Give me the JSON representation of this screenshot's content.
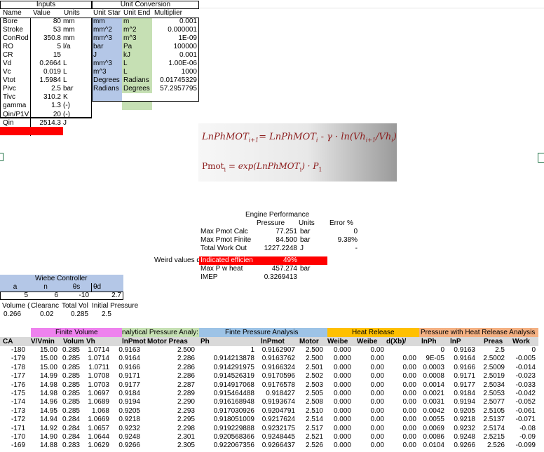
{
  "inputs": {
    "title": "Inputs",
    "headers": [
      "Name",
      "Value",
      "Units"
    ],
    "rows": [
      [
        "Bore",
        "80",
        "mm"
      ],
      [
        "Stroke",
        "53",
        "mm"
      ],
      [
        "ConRod",
        "350.8",
        "mm"
      ],
      [
        "RO",
        "5",
        "l/a"
      ],
      [
        "CR",
        "15",
        ""
      ],
      [
        "Vd",
        "0.2664",
        "L"
      ],
      [
        "Vc",
        "0.019",
        "L"
      ],
      [
        "Vtot",
        "1.5984",
        "L"
      ],
      [
        "Pivc",
        "2.5",
        "bar"
      ],
      [
        "Tivc",
        "310.2",
        "K"
      ],
      [
        "gamma",
        "1.3",
        "(-)"
      ],
      [
        "Qin/P1V",
        "20",
        "(-)"
      ],
      [
        "Qin",
        "2514.3",
        "J"
      ]
    ]
  },
  "unit_conversion": {
    "title": "Unit Conversion",
    "headers": [
      "Unit Star",
      "Unit End",
      "Multiplier"
    ],
    "rows": [
      [
        "mm",
        "m",
        "0.001"
      ],
      [
        "mm^2",
        "m^2",
        "0.000001"
      ],
      [
        "mm^3",
        "m^3",
        "1E-09"
      ],
      [
        "bar",
        "Pa",
        "100000"
      ],
      [
        "J",
        "kJ",
        "0.001"
      ],
      [
        "mm^3",
        "L",
        "1.00E-06"
      ],
      [
        "m^3",
        "L",
        "1000"
      ],
      [
        "Degrees",
        "Radians",
        "0.01745329"
      ],
      [
        "Radians",
        "Degrees",
        "57.2957795"
      ]
    ]
  },
  "equations": {
    "eq1": "LnPhMOT",
    "eq1_sub": "i+1",
    "eq1_mid": "= LnPhMOT",
    "eq1_sub2": "i",
    "eq1_rest": "- γ · ln(Vh",
    "eq1_sub3": "i+1",
    "eq1_tail": "/Vh",
    "eq1_sub4": "i",
    "eq1_end": ")",
    "eq2_a": "Pmot",
    "eq2_sub": "i",
    "eq2_b": "= exp(LnPhMOT",
    "eq2_sub2": "i",
    "eq2_c": ") · P",
    "eq2_sub3": "1"
  },
  "engine_performance": {
    "title": "Engine Performance",
    "headers": [
      "Pressure",
      "Units",
      "Error %"
    ],
    "rows": [
      {
        "label": "Max Pmot Calc",
        "value": "77.251",
        "unit": "bar",
        "err": "0"
      },
      {
        "label": "Max Pmot Finite",
        "value": "84.500",
        "unit": "bar",
        "err": "9.38%"
      },
      {
        "label": "Total Work Out",
        "value": "1227.2248",
        "unit": "J",
        "err": "-"
      },
      {
        "label": "Indicated efficien",
        "value": "49%",
        "unit": "",
        "err": ""
      },
      {
        "label": "Max P w heat",
        "value": "457.274",
        "unit": "bar",
        "err": ""
      },
      {
        "label": "IMEP",
        "value": "0.3269413",
        "unit": "",
        "err": ""
      }
    ],
    "weird_note": "Weird values d"
  },
  "wiebe": {
    "title": "Wiebe Controller",
    "headers": [
      "a",
      "n",
      "θs",
      "θd"
    ],
    "values": [
      "5",
      "6",
      "-10",
      "2.7"
    ],
    "vol_headers": [
      "Volume (",
      "Clearanc",
      "Total Vol",
      "Initial Pressure"
    ],
    "vol_values": [
      "0.266",
      "0.02",
      "0.285",
      "2.5"
    ]
  },
  "table": {
    "groups": [
      "Finite Volume",
      "nalytical Pressure Analy:",
      "Finte Pressure Analysis",
      "Heat Release",
      "Pressure with Heat Release Analysis"
    ],
    "headers": [
      "CA",
      "V/Vmin",
      "Volum",
      "Vh",
      "lnPmot",
      "Motor Preas",
      "Ph",
      "lnPmot",
      "Motor",
      "Weibe",
      "Weibe",
      "d(Xb)/",
      "lnPh",
      "lnP",
      "Preas",
      "Work"
    ],
    "rows": [
      [
        "-180",
        "15.00",
        "0.285",
        "1.0714",
        "0.9163",
        "2.500",
        "1",
        "0.9162907",
        "2.500",
        "0.000",
        "0.00",
        "",
        "0",
        "0.9163",
        "2.5",
        "0"
      ],
      [
        "-179",
        "15.00",
        "0.285",
        "1.0714",
        "0.9164",
        "2.286",
        "0.914213878",
        "0.9163762",
        "2.500",
        "0.000",
        "0.00",
        "0.00",
        "9E-05",
        "0.9164",
        "2.5002",
        "-0.005"
      ],
      [
        "-178",
        "15.00",
        "0.285",
        "1.0711",
        "0.9166",
        "2.286",
        "0.914291975",
        "0.9166324",
        "2.501",
        "0.000",
        "0.00",
        "0.00",
        "0.0003",
        "0.9166",
        "2.5009",
        "-0.014"
      ],
      [
        "-177",
        "14.99",
        "0.285",
        "1.0708",
        "0.9171",
        "2.286",
        "0.914526319",
        "0.9170596",
        "2.502",
        "0.000",
        "0.00",
        "0.00",
        "0.0008",
        "0.9171",
        "2.5019",
        "-0.023"
      ],
      [
        "-176",
        "14.98",
        "0.285",
        "1.0703",
        "0.9177",
        "2.287",
        "0.914917068",
        "0.9176578",
        "2.503",
        "0.000",
        "0.00",
        "0.00",
        "0.0014",
        "0.9177",
        "2.5034",
        "-0.033"
      ],
      [
        "-175",
        "14.98",
        "0.285",
        "1.0697",
        "0.9184",
        "2.289",
        "0.915464488",
        "0.918427",
        "2.505",
        "0.000",
        "0.00",
        "0.00",
        "0.0021",
        "0.9184",
        "2.5053",
        "-0.042"
      ],
      [
        "-174",
        "14.96",
        "0.285",
        "1.0689",
        "0.9194",
        "2.290",
        "0.916168948",
        "0.9193674",
        "2.508",
        "0.000",
        "0.00",
        "0.00",
        "0.0031",
        "0.9194",
        "2.5077",
        "-0.052"
      ],
      [
        "-173",
        "14.95",
        "0.285",
        "1.068",
        "0.9205",
        "2.293",
        "0.917030926",
        "0.9204791",
        "2.510",
        "0.000",
        "0.00",
        "0.00",
        "0.0042",
        "0.9205",
        "2.5105",
        "-0.061"
      ],
      [
        "-172",
        "14.94",
        "0.284",
        "1.0669",
        "0.9218",
        "2.295",
        "0.918051009",
        "0.9217624",
        "2.514",
        "0.000",
        "0.00",
        "0.00",
        "0.0055",
        "0.9218",
        "2.5137",
        "-0.071"
      ],
      [
        "-171",
        "14.92",
        "0.284",
        "1.0657",
        "0.9232",
        "2.298",
        "0.919229888",
        "0.9232175",
        "2.517",
        "0.000",
        "0.00",
        "0.00",
        "0.0069",
        "0.9232",
        "2.5174",
        "-0.08"
      ],
      [
        "-170",
        "14.90",
        "0.284",
        "1.0644",
        "0.9248",
        "2.301",
        "0.920568366",
        "0.9248445",
        "2.521",
        "0.000",
        "0.00",
        "0.00",
        "0.0086",
        "0.9248",
        "2.5215",
        "-0.09"
      ],
      [
        "-169",
        "14.88",
        "0.283",
        "1.0629",
        "0.9266",
        "2.305",
        "0.922067356",
        "0.9266437",
        "2.526",
        "0.000",
        "0.00",
        "0.00",
        "0.0104",
        "0.9266",
        "2.526",
        "-0.099"
      ]
    ]
  },
  "colors": {
    "blue_fill": "#b4c7e7",
    "green_fill": "#c6e0b4",
    "red_fill": "#ff0000",
    "pink_fill": "#ee82ee",
    "lightblue_fill": "#9dc3e6",
    "orange_fill": "#ffc000",
    "peach_fill": "#f4b183",
    "gray_fill": "#d9d9d9",
    "accent_green": "#217346"
  }
}
